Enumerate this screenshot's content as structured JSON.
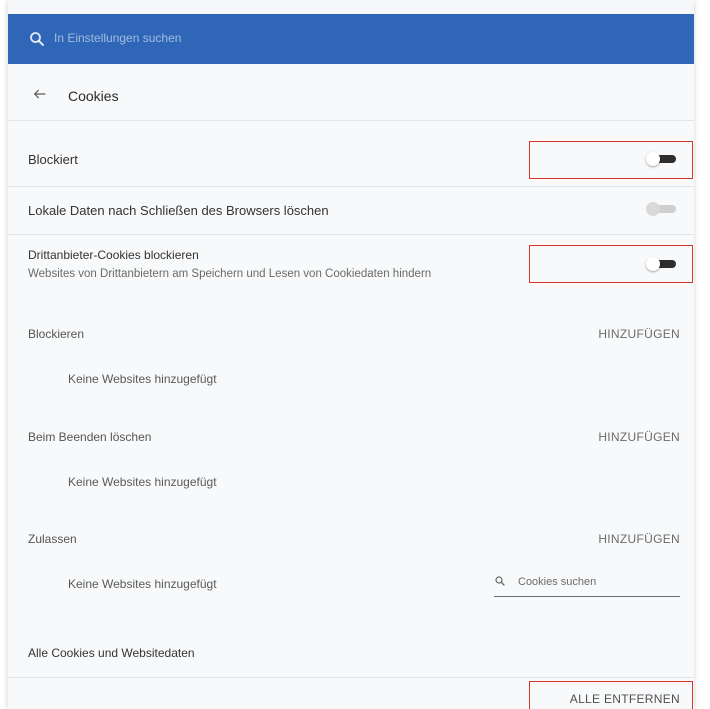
{
  "search": {
    "placeholder": "In Einstellungen suchen"
  },
  "header": {
    "title": "Cookies"
  },
  "settings": {
    "blocked_label": "Blockiert",
    "blocked_state": "off",
    "clear_on_exit_label": "Lokale Daten nach Schließen des Browsers löschen",
    "clear_on_exit_state": "disabled",
    "third_party_label": "Drittanbieter-Cookies blockieren",
    "third_party_description": "Websites von Drittanbietern am Speichern und Lesen von Cookiedaten hindern",
    "third_party_state": "off"
  },
  "sections": [
    {
      "title": "Blockieren",
      "add_label": "HINZUFÜGEN",
      "empty_text": "Keine Websites hinzugefügt"
    },
    {
      "title": "Beim Beenden löschen",
      "add_label": "HINZUFÜGEN",
      "empty_text": "Keine Websites hinzugefügt"
    },
    {
      "title": "Zulassen",
      "add_label": "HINZUFÜGEN",
      "empty_text": "Keine Websites hinzugefügt"
    }
  ],
  "all_cookies": {
    "label": "Alle Cookies und Websitedaten",
    "search_placeholder": "Cookies suchen",
    "remove_all_label": "ALLE ENTFERNEN"
  },
  "colors": {
    "topbar": "#2f66b8",
    "highlight": "#d9332b",
    "toggle_dark": "#2e2e2e"
  }
}
